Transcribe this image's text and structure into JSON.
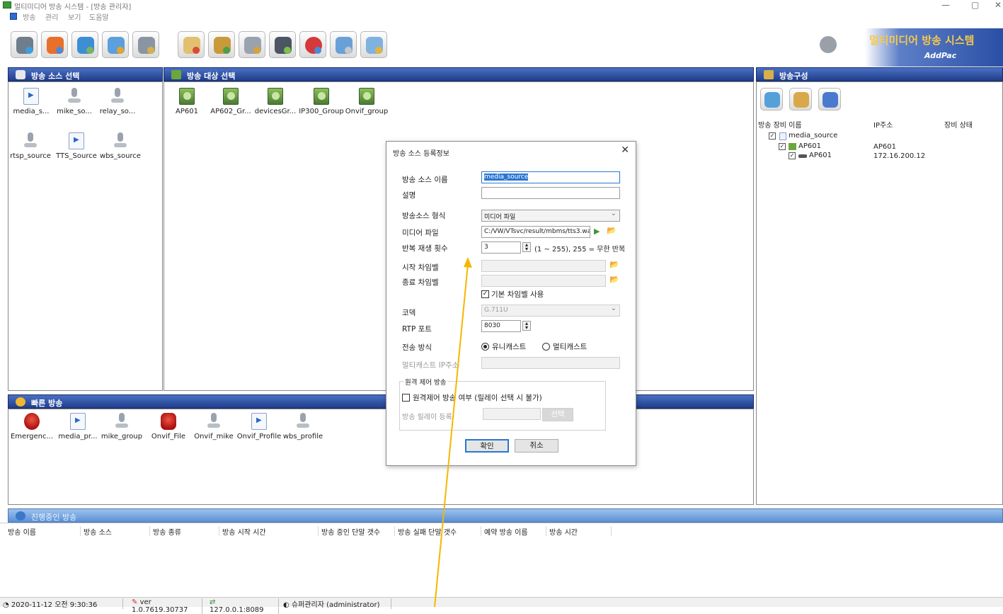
{
  "window": {
    "title": "멀티미디어 방송 시스템 - [방송 관리자]",
    "min": "—",
    "max": "▢",
    "close": "✕"
  },
  "menu": [
    "방송",
    "관리",
    "보기",
    "도움말"
  ],
  "toolbar": {
    "buttons": [
      "speaker-broadcast",
      "fire-alarm",
      "network-config",
      "user-group",
      "user-settings",
      "document-edit",
      "user-profile",
      "gear-settings",
      "camera-broadcast",
      "emergency-119",
      "network-monitor",
      "schedule-list",
      "help-info"
    ]
  },
  "brand": {
    "title": "멀티미디어 방송 시스템",
    "sub": "AddPac"
  },
  "source_panel": {
    "title": "방송 소스 선택",
    "items": [
      {
        "label": "media_s...",
        "icon": "file"
      },
      {
        "label": "mike_so...",
        "icon": "mic"
      },
      {
        "label": "relay_so...",
        "icon": "mic"
      },
      {
        "label": "rtsp_source",
        "icon": "mic"
      },
      {
        "label": "TTS_Source",
        "icon": "file"
      },
      {
        "label": "wbs_source",
        "icon": "mic"
      }
    ]
  },
  "target_panel": {
    "title": "방송 대상 선택",
    "items": [
      "AP601",
      "AP602_Gr...",
      "devicesGr...",
      "IP300_Group",
      "Onvif_group"
    ]
  },
  "config_panel": {
    "title": "방송구성",
    "columns": [
      "방송 장비 이름",
      "IP주소",
      "장비 상태"
    ],
    "tree": [
      {
        "name": "media_source",
        "ip": ""
      },
      {
        "name": "AP601",
        "ip": "AP601"
      },
      {
        "name": "AP601",
        "ip": "172.16.200.12"
      }
    ]
  },
  "quick_panel": {
    "title": "빠른 방송",
    "items": [
      {
        "label": "Emergenc...",
        "icon": "emergency"
      },
      {
        "label": "media_pr...",
        "icon": "file"
      },
      {
        "label": "mike_group",
        "icon": "mic"
      },
      {
        "label": "Onvif_File",
        "icon": "alarm"
      },
      {
        "label": "Onvif_mike",
        "icon": "mic"
      },
      {
        "label": "Onvif_Profile",
        "icon": "file"
      },
      {
        "label": "wbs_profile",
        "icon": "mic"
      }
    ]
  },
  "active_panel": {
    "title": "진행중인 방송",
    "columns": [
      "방송 이름",
      "방송 소스",
      "방송 종류",
      "방송 시작 시간",
      "방송 중인 단말 갯수",
      "방송 실패 단말 갯수",
      "예약 방송 이름",
      "방송 시간"
    ]
  },
  "dialog": {
    "title": "방송 소스 등록정보",
    "close": "✕",
    "fields": {
      "name_label": "방송 소스 이름",
      "name_value": "media_source",
      "desc_label": "설명",
      "desc_value": "",
      "type_label": "방송소스 형식",
      "type_value": "미디어 파일",
      "file_label": "미디어 파일",
      "file_value": "C:/VW/VTsvc/result/mbms/tts3.wav",
      "repeat_label": "반복 재생 횟수",
      "repeat_value": "3",
      "repeat_hint": "(1 ~ 255), 255 = 무한 반복",
      "start_chime_label": "시작 차임벨",
      "end_chime_label": "종료 차임벨",
      "default_chime_label": "기본 차임벨 사용",
      "codec_label": "코덱",
      "codec_value": "G.711U",
      "rtp_label": "RTP 포트",
      "rtp_value": "8030",
      "mode_label": "전송 방식",
      "unicast": "유니캐스트",
      "multicast": "멀티캐스트",
      "mcast_ip_label": "멀티캐스트 IP주소",
      "remote_group": "원격 제어 방송",
      "remote_check": "원격제어 방송 여부 (릴레이 선택 시 불가)",
      "relay_label": "방송 릴레이 등록",
      "relay_button": "선택"
    },
    "ok": "확인",
    "cancel": "취소"
  },
  "status": {
    "datetime": "2020-11-12 오전 9:30:36",
    "version": "ver 1.0.7619.30737",
    "server": "127.0.0.1:8089",
    "user": "슈퍼관리자 (administrator)"
  },
  "colors": {
    "header": "#203d8a",
    "annotation_arrow": "#f5b700"
  }
}
